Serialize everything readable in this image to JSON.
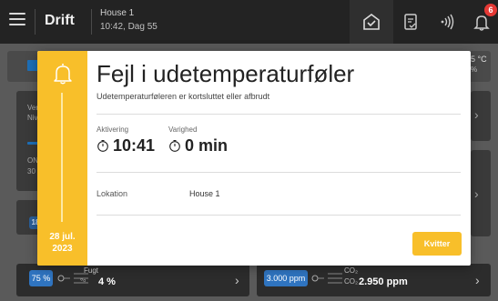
{
  "topbar": {
    "title": "Drift",
    "house_name": "House 1",
    "house_time": "10:42, Dag 55",
    "alarm_count": "6"
  },
  "background": {
    "temp_partial": "5 °C",
    "temp_unit_partial": "%",
    "card_left_text_1": "Ver",
    "card_left_text_2": "Niv",
    "card_left_text_3": "ON",
    "card_left_text_4": "30",
    "pill_left_partial": "18",
    "humidity": {
      "pill": "75 %",
      "label": "Fugt",
      "value": "4 %"
    },
    "co2": {
      "pill": "3.000 ppm",
      "label": "CO₂",
      "sub": "CO₂",
      "value": "2.950 ppm"
    }
  },
  "alarm": {
    "title": "Fejl i udetemperaturføler",
    "description": "Udetemperaturføleren er kortsluttet eller afbrudt",
    "activation_label": "Aktivering",
    "activation_value": "10:41",
    "duration_label": "Varighed",
    "duration_value": "0 min",
    "location_label": "Lokation",
    "location_value": "House 1",
    "date_line1": "28 jul.",
    "date_line2": "2023",
    "ack_button": "Kvitter",
    "accent_color": "#f8bf2a"
  }
}
